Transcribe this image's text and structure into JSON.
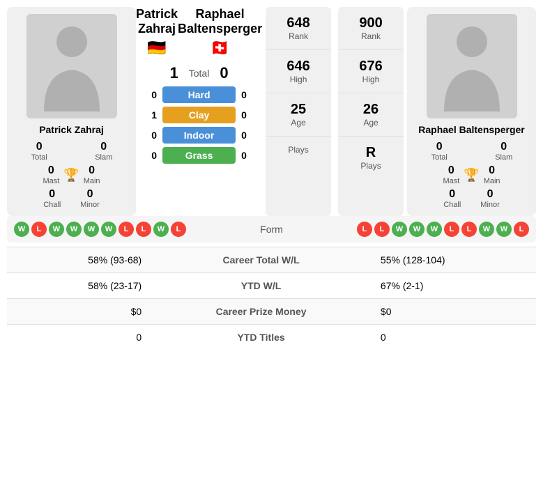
{
  "players": {
    "left": {
      "name": "Patrick Zahraj",
      "flag": "🇩🇪",
      "total": "0",
      "slam": "0",
      "mast": "0",
      "main": "0",
      "chall": "0",
      "minor": "0",
      "rank": "648",
      "high": "646",
      "age": "25",
      "plays": ""
    },
    "right": {
      "name": "Raphael Baltensperger",
      "flag": "🇨🇭",
      "total": "0",
      "slam": "0",
      "mast": "0",
      "main": "0",
      "chall": "0",
      "minor": "0",
      "rank": "900",
      "high": "676",
      "age": "26",
      "plays": "R"
    }
  },
  "head_to_head": {
    "left_total": "1",
    "right_total": "0",
    "total_label": "Total",
    "surfaces": [
      {
        "label": "Hard",
        "left": "0",
        "right": "0",
        "type": "hard"
      },
      {
        "label": "Clay",
        "left": "1",
        "right": "0",
        "type": "clay"
      },
      {
        "label": "Indoor",
        "left": "0",
        "right": "0",
        "type": "indoor"
      },
      {
        "label": "Grass",
        "left": "0",
        "right": "0",
        "type": "grass"
      }
    ]
  },
  "form": {
    "label": "Form",
    "left": [
      "W",
      "L",
      "W",
      "W",
      "W",
      "W",
      "L",
      "L",
      "W",
      "L"
    ],
    "right": [
      "L",
      "L",
      "W",
      "W",
      "W",
      "L",
      "L",
      "W",
      "W",
      "L"
    ]
  },
  "stats": [
    {
      "label": "Career Total W/L",
      "left": "58% (93-68)",
      "right": "55% (128-104)"
    },
    {
      "label": "YTD W/L",
      "left": "58% (23-17)",
      "right": "67% (2-1)"
    },
    {
      "label": "Career Prize Money",
      "left": "$0",
      "right": "$0"
    },
    {
      "label": "YTD Titles",
      "left": "0",
      "right": "0"
    }
  ],
  "labels": {
    "total": "Total",
    "slam": "Slam",
    "mast": "Mast",
    "main": "Main",
    "chall": "Chall",
    "minor": "Minor",
    "rank": "Rank",
    "high": "High",
    "age": "Age",
    "plays": "Plays"
  }
}
